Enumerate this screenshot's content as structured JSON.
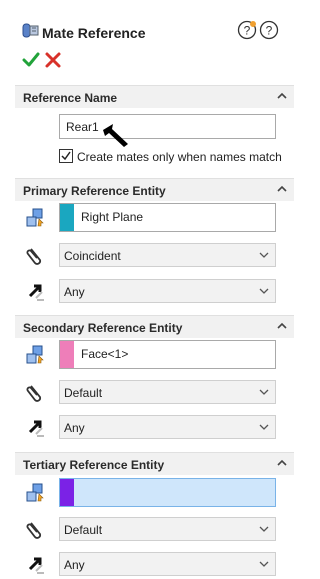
{
  "panel": {
    "title": "Mate Reference"
  },
  "reference_name": {
    "header": "Reference Name",
    "value": "Rear1",
    "checkbox_label": "Create mates only when names match",
    "checkbox_checked": true
  },
  "primary": {
    "header": "Primary Reference Entity",
    "entity": "Right Plane",
    "swatch_color": "#1aa7c0",
    "mate_type": "Coincident",
    "alignment": "Any"
  },
  "secondary": {
    "header": "Secondary Reference Entity",
    "entity": "Face<1>",
    "swatch_color": "#ee7eb9",
    "mate_type": "Default",
    "alignment": "Any"
  },
  "tertiary": {
    "header": "Tertiary Reference Entity",
    "entity": "",
    "swatch_color": "#7b22e6",
    "field_bg": "#cfe6fb",
    "field_border": "#79b3e8",
    "mate_type": "Default",
    "alignment": "Any"
  },
  "icons": {
    "title": "mate-reference-icon",
    "help_new": "help-whats-new-icon",
    "help": "help-icon",
    "ok": "checkmark-icon",
    "cancel": "close-icon",
    "entity": "reference-entity-icon",
    "mate_type": "paperclip-mate-icon",
    "alignment": "alignment-arrow-icon"
  }
}
